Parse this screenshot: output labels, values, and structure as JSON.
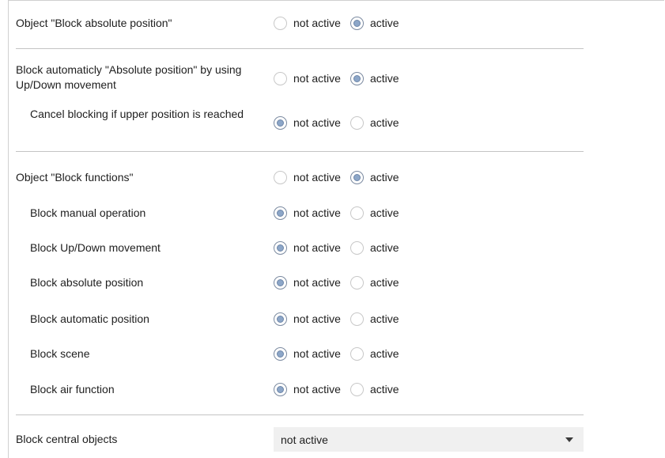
{
  "rows": [
    {
      "label": "Object \"Block absolute position\"",
      "selected": "active"
    },
    {
      "label": "Block automaticly \"Absolute position\" by using Up/Down movement",
      "selected": "active"
    },
    {
      "label": "Cancel blocking if upper position is reached",
      "selected": "not active"
    },
    {
      "label": "Object \"Block functions\"",
      "selected": "active"
    },
    {
      "label": "Block manual operation",
      "selected": "not active"
    },
    {
      "label": "Block Up/Down movement",
      "selected": "not active"
    },
    {
      "label": "Block absolute position",
      "selected": "not active"
    },
    {
      "label": "Block automatic position",
      "selected": "not active"
    },
    {
      "label": "Block scene",
      "selected": "not active"
    },
    {
      "label": "Block air function",
      "selected": "not active"
    }
  ],
  "option_labels": {
    "not_active": "not active",
    "active": "active"
  },
  "central": {
    "label": "Block central objects",
    "value": "not active"
  }
}
